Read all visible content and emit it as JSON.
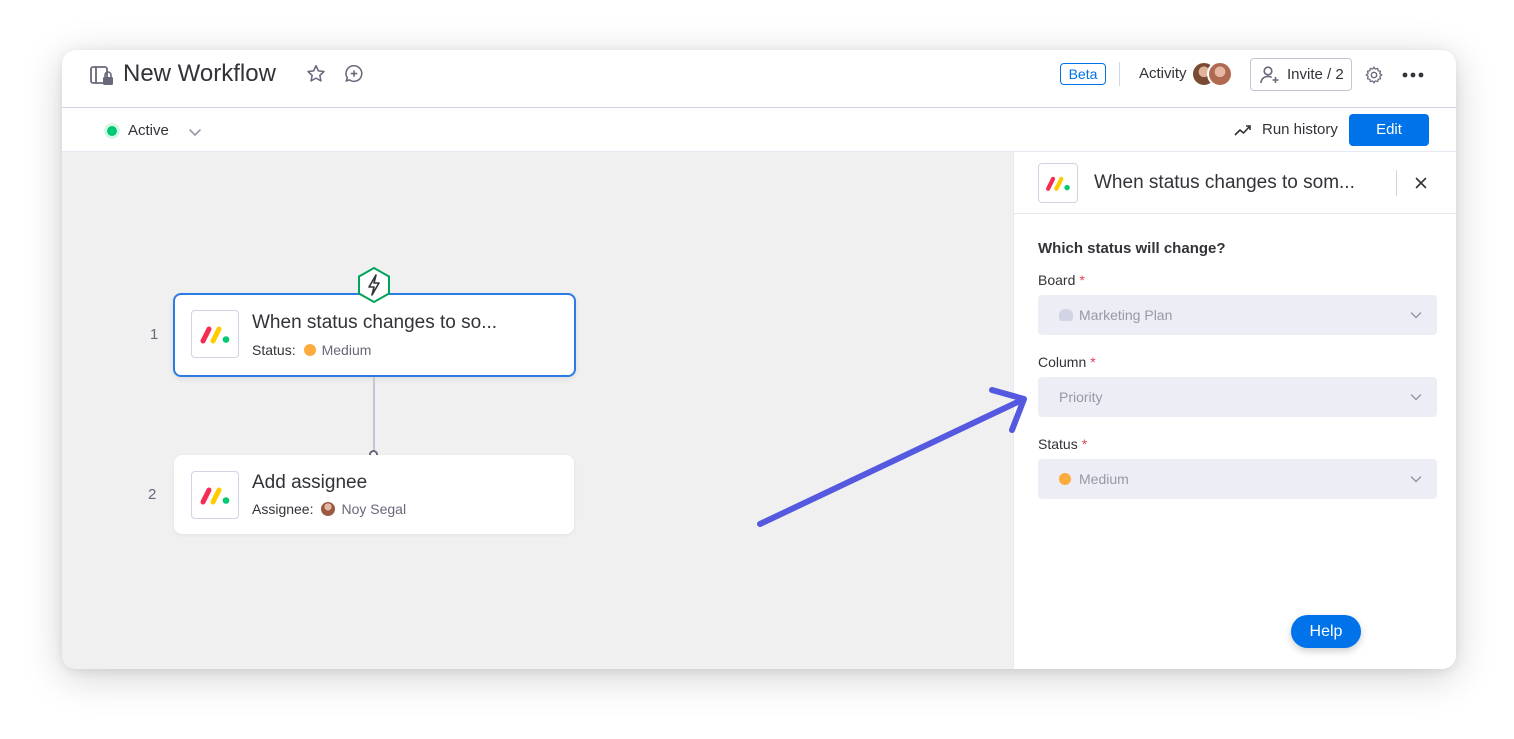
{
  "header": {
    "title": "New Workflow",
    "beta_label": "Beta",
    "activity_label": "Activity",
    "invite_label": "Invite / 2"
  },
  "subheader": {
    "status_label": "Active",
    "run_history_label": "Run history",
    "edit_label": "Edit"
  },
  "workflow": {
    "steps": [
      {
        "number": "1",
        "title": "When status changes to so...",
        "sub_label": "Status:",
        "sub_value": "Medium"
      },
      {
        "number": "2",
        "title": "Add assignee",
        "sub_label": "Assignee:",
        "sub_value": "Noy Segal"
      }
    ]
  },
  "panel": {
    "title": "When status changes to som...",
    "section_title": "Which status will change?",
    "fields": [
      {
        "label": "Board",
        "required": "*",
        "value": "Marketing Plan"
      },
      {
        "label": "Column",
        "required": "*",
        "value": "Priority"
      },
      {
        "label": "Status",
        "required": "*",
        "value": "Medium"
      }
    ],
    "help_label": "Help"
  },
  "colors": {
    "accent": "#0073ea",
    "active_green": "#00c875",
    "medium_orange": "#fdab3d",
    "arrow": "#5559df"
  }
}
